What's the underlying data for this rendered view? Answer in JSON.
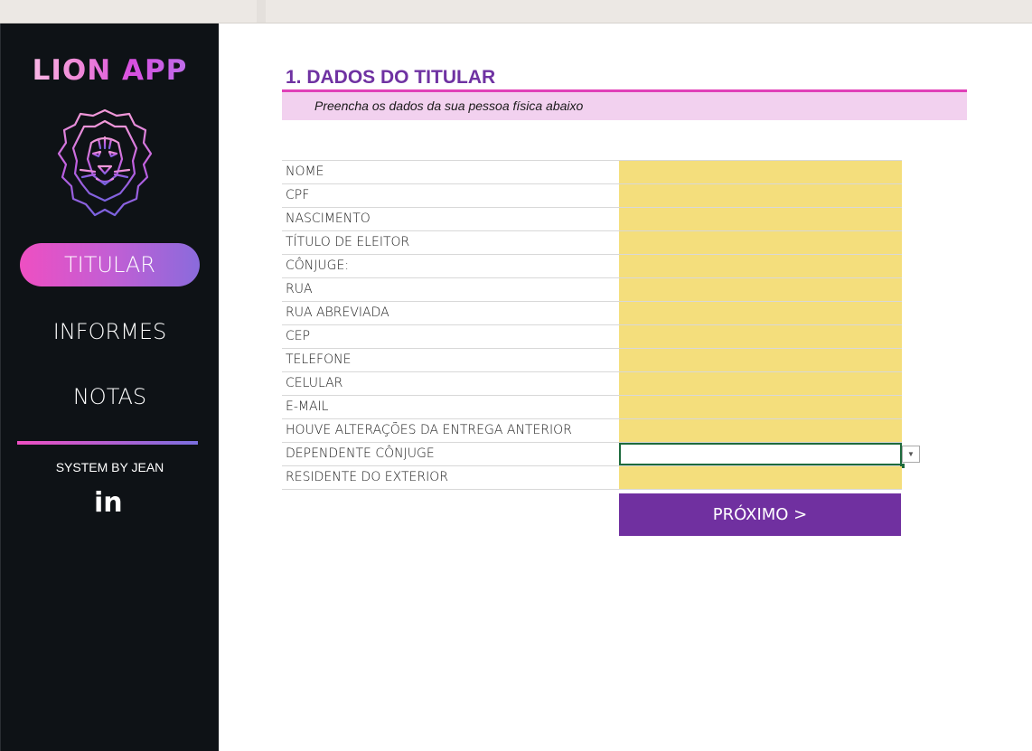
{
  "app": {
    "logo_text": "LION APP",
    "brand_gradient": [
      "#ee4fc2",
      "#8a6bdc"
    ],
    "sidebar_bg": "#0e1216"
  },
  "sidebar": {
    "nav": [
      {
        "label": "TITULAR",
        "active": true
      },
      {
        "label": "INFORMES",
        "active": false
      },
      {
        "label": "NOTAS",
        "active": false
      }
    ],
    "credit": "SYSTEM BY JEAN",
    "social_icon": "linkedin-icon",
    "social_text": "in"
  },
  "main": {
    "section_title": "1. DADOS DO TITULAR",
    "subtitle": "Preencha os dados da sua pessoa física abaixo",
    "accent_color": "#7030a0",
    "input_fill_color": "#f4de7c",
    "fields": [
      {
        "label": "NOME",
        "value": ""
      },
      {
        "label": "CPF",
        "value": ""
      },
      {
        "label": "NASCIMENTO",
        "value": ""
      },
      {
        "label": "TÍTULO DE ELEITOR",
        "value": ""
      },
      {
        "label": "CÔNJUGE:",
        "value": ""
      },
      {
        "label": "RUA",
        "value": ""
      },
      {
        "label": "RUA ABREVIADA",
        "value": ""
      },
      {
        "label": "CEP",
        "value": ""
      },
      {
        "label": "TELEFONE",
        "value": ""
      },
      {
        "label": "CELULAR",
        "value": ""
      },
      {
        "label": "E-MAIL",
        "value": ""
      },
      {
        "label": "HOUVE ALTERAÇÕES DA ENTREGA ANTERIOR",
        "value": ""
      },
      {
        "label": "DEPENDENTE CÔNJUGE",
        "value": "",
        "selected": true,
        "has_dropdown": true
      },
      {
        "label": "RESIDENTE DO EXTERIOR",
        "value": ""
      }
    ],
    "next_button": "PRÓXIMO >"
  }
}
